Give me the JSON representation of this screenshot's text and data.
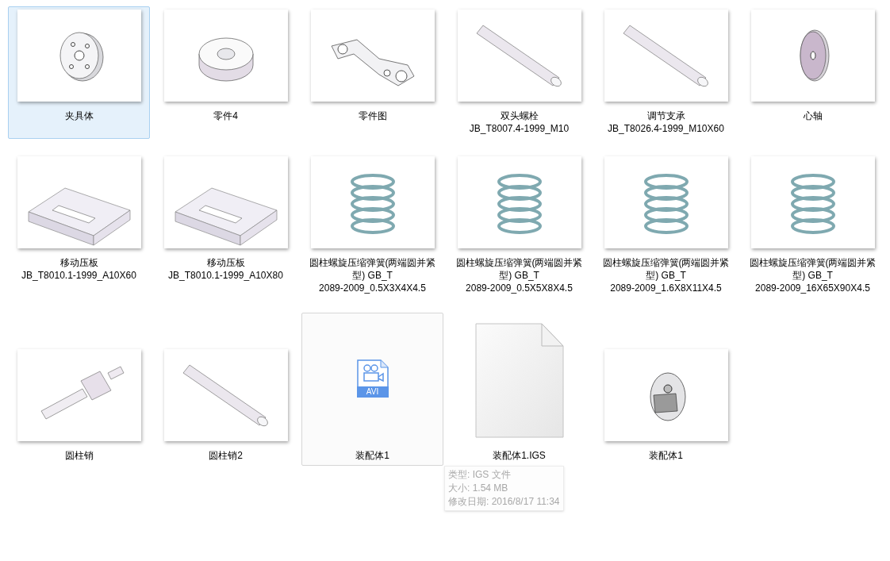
{
  "files": [
    {
      "kind": "disc",
      "label": "夹具体",
      "selected": true,
      "hovered": false
    },
    {
      "kind": "ring",
      "label": "零件4",
      "selected": false,
      "hovered": false
    },
    {
      "kind": "bracket",
      "label": "零件图",
      "selected": false,
      "hovered": false
    },
    {
      "kind": "rod",
      "label": "双头螺栓 JB_T8007.4-1999_M10",
      "selected": false,
      "hovered": false
    },
    {
      "kind": "rod",
      "label": "调节支承 JB_T8026.4-1999_M10X60",
      "selected": false,
      "hovered": false
    },
    {
      "kind": "washer",
      "label": "心轴",
      "selected": false,
      "hovered": false
    },
    {
      "kind": "plate",
      "label": "移动压板 JB_T8010.1-1999_A10X60",
      "selected": false,
      "hovered": false
    },
    {
      "kind": "plate",
      "label": "移动压板 JB_T8010.1-1999_A10X80",
      "selected": false,
      "hovered": false
    },
    {
      "kind": "spring",
      "label": "圆柱螺旋压缩弹簧(两端圆并紧型) GB_T 2089-2009_0.5X3X4X4.5",
      "selected": false,
      "hovered": false
    },
    {
      "kind": "spring",
      "label": "圆柱螺旋压缩弹簧(两端圆并紧型) GB_T 2089-2009_0.5X5X8X4.5",
      "selected": false,
      "hovered": false
    },
    {
      "kind": "spring",
      "label": "圆柱螺旋压缩弹簧(两端圆并紧型) GB_T 2089-2009_1.6X8X11X4.5",
      "selected": false,
      "hovered": false
    },
    {
      "kind": "spring",
      "label": "圆柱螺旋压缩弹簧(两端圆并紧型) GB_T 2089-2009_16X65X90X4.5",
      "selected": false,
      "hovered": false
    },
    {
      "kind": "pin",
      "label": "圆柱销",
      "selected": false,
      "hovered": false
    },
    {
      "kind": "rod",
      "label": "圆柱销2",
      "selected": false,
      "hovered": false
    },
    {
      "kind": "video",
      "label": "装配体1",
      "badge": "AVI",
      "selected": false,
      "hovered": true
    },
    {
      "kind": "document",
      "label": "装配体1.IGS",
      "selected": false,
      "hovered": false,
      "tooltip": [
        "类型: IGS 文件",
        "大小: 1.54 MB",
        "修改日期: 2016/8/17 11:34"
      ]
    },
    {
      "kind": "assembly",
      "label": "装配体1",
      "selected": false,
      "hovered": false
    }
  ]
}
